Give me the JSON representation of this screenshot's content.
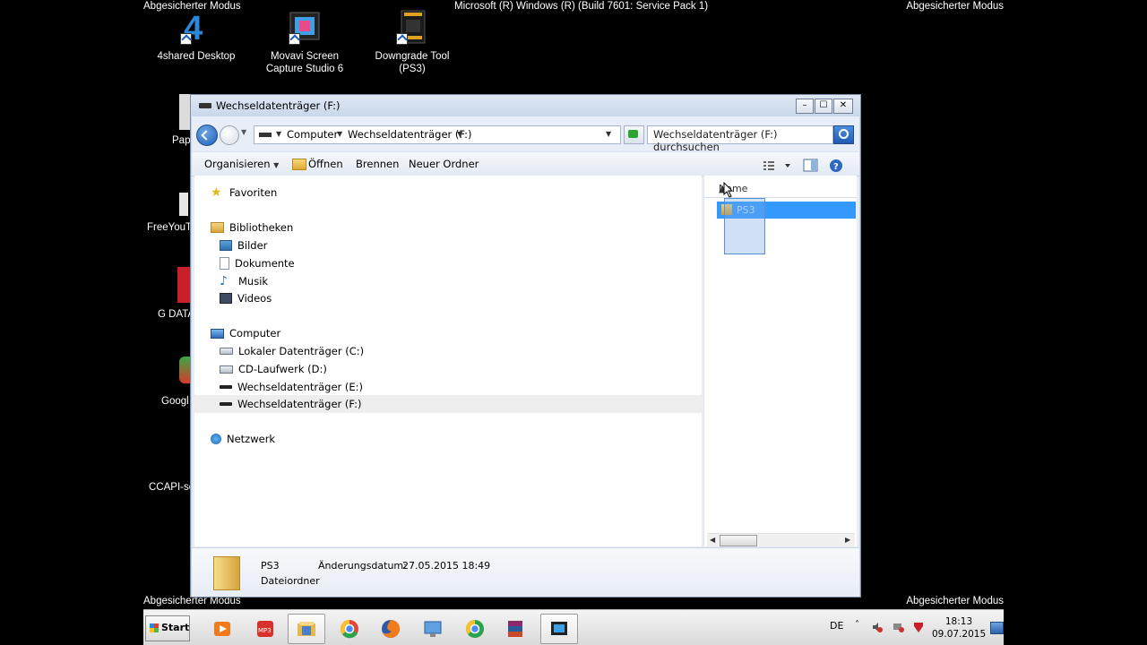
{
  "desktop": {
    "safe_mode_label": "Abgesicherter Modus",
    "build_text": "Microsoft (R) Windows (R) (Build 7601: Service Pack 1)",
    "icons": [
      {
        "label": "4shared Desktop"
      },
      {
        "label": "Movavi Screen Capture Studio 6"
      },
      {
        "label": "Downgrade Tool (PS3)"
      }
    ],
    "clipped_icons": [
      {
        "label": "Pap"
      },
      {
        "label": "FreeYouT"
      },
      {
        "label": "G DATA"
      },
      {
        "label": "Googl"
      },
      {
        "label": "CCAPI-se"
      }
    ]
  },
  "window": {
    "title": "Wechseldatenträger (F:)",
    "buttons": {
      "minimize": "–",
      "maximize": "☐",
      "close": "✕"
    },
    "address": {
      "crumb1": "Computer",
      "crumb2": "Wechseldatenträger (F:)"
    },
    "search_placeholder": "Wechseldatenträger (F:) durchsuchen",
    "toolbar": {
      "organize": "Organisieren",
      "open": "Öffnen",
      "burn": "Brennen",
      "new_folder": "Neuer Ordner"
    },
    "nav": {
      "favorites": "Favoriten",
      "libraries": "Bibliotheken",
      "pictures": "Bilder",
      "documents": "Dokumente",
      "music": "Musik",
      "videos": "Videos",
      "computer": "Computer",
      "drive_c": "Lokaler Datenträger (C:)",
      "drive_d": "CD-Laufwerk (D:)",
      "drive_e": "Wechseldatenträger (E:)",
      "drive_f": "Wechseldatenträger (F:)",
      "network": "Netzwerk"
    },
    "file_list": {
      "column_name": "Name",
      "items": [
        {
          "name": "PS3"
        }
      ]
    },
    "details": {
      "name": "PS3",
      "type": "Dateiordner",
      "modified_label": "Änderungsdatum:",
      "modified_value": "27.05.2015 18:49"
    }
  },
  "taskbar": {
    "start_label": "Start",
    "language": "DE",
    "time": "18:13",
    "date": "09.07.2015"
  },
  "colors": {
    "selection": "#3399ff",
    "accent": "#1d5fb5"
  }
}
